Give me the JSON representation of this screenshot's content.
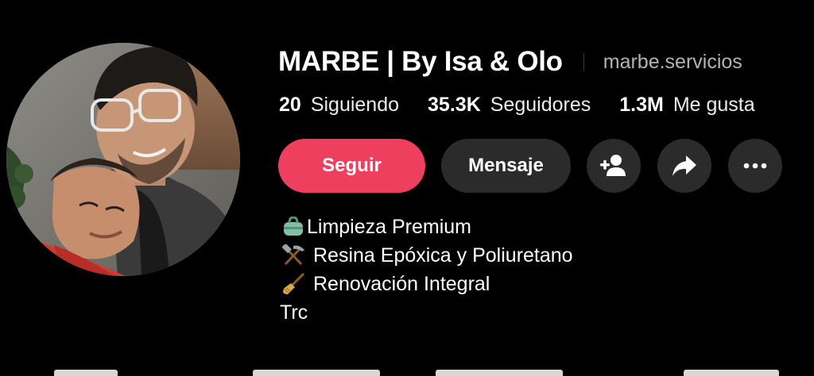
{
  "profile": {
    "display_name": "MARBE | By Isa & Olo",
    "username": "marbe.servicios"
  },
  "stats": [
    {
      "value": "20",
      "label": "Siguiendo"
    },
    {
      "value": "35.3K",
      "label": "Seguidores"
    },
    {
      "value": "1.3M",
      "label": "Me gusta"
    }
  ],
  "actions": {
    "follow_label": "Seguir",
    "message_label": "Mensaje",
    "icons": [
      "add-friend-icon",
      "share-icon",
      "more-icon"
    ]
  },
  "bio": {
    "lines": [
      {
        "icon": "bag-icon",
        "text": "Limpieza Premium"
      },
      {
        "icon": "hammer-pick-icon",
        "text": "Resina Epóxica y Poliuretano"
      },
      {
        "icon": "broom-icon",
        "text": "Renovación Integral"
      },
      {
        "icon": "",
        "text": "Trc"
      }
    ]
  },
  "colors": {
    "background": "#000000",
    "follow_button": "#ee3f5f",
    "secondary_button": "#2b2b2b",
    "muted_text": "#b3b3b3"
  }
}
